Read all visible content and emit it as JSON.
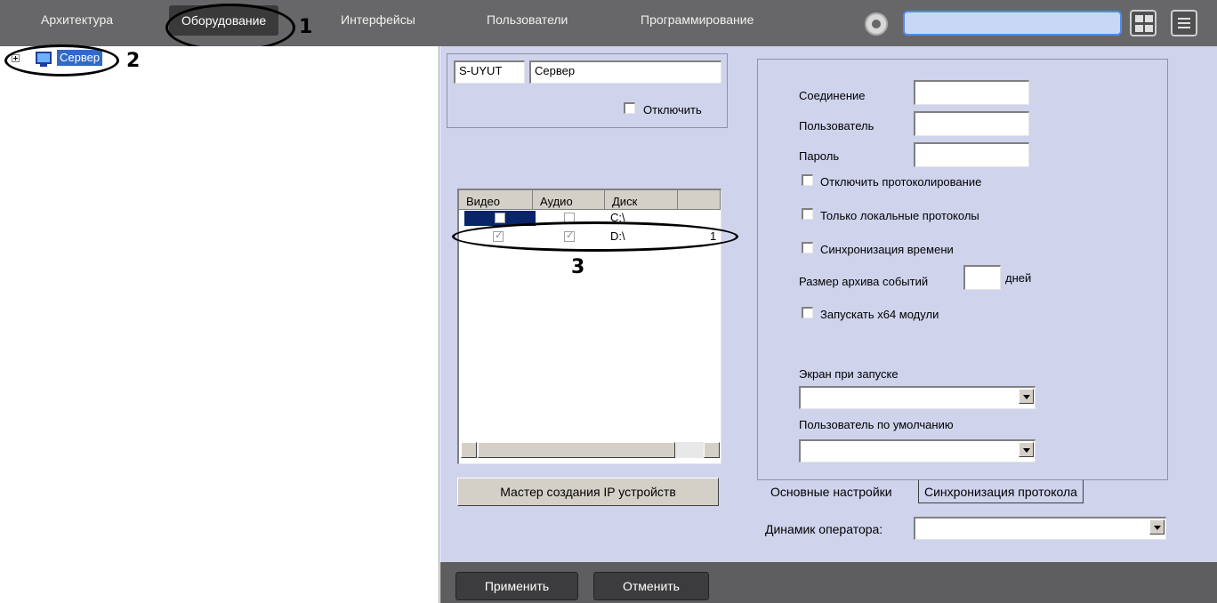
{
  "nav": {
    "tabs": [
      "Архитектура",
      "Оборудование",
      "Интерфейсы",
      "Пользователи",
      "Программирование"
    ],
    "active_tab": "Оборудование"
  },
  "callouts": [
    "1",
    "2",
    "3"
  ],
  "tree": {
    "root_label": "Сервер"
  },
  "server": {
    "id": "S-UYUT",
    "name": "Сервер",
    "disable_label": "Отключить"
  },
  "disks": {
    "columns": [
      "Видео",
      "Аудио",
      "Диск"
    ],
    "rows": [
      {
        "video": false,
        "audio": false,
        "disk": "C:\\",
        "extra": "",
        "video_selected": true
      },
      {
        "video": true,
        "audio": true,
        "disk": "D:\\",
        "extra": "1",
        "video_selected": false
      }
    ]
  },
  "settings": {
    "connection_label": "Соединение",
    "user_label": "Пользователь",
    "password_label": "Пароль",
    "disable_logging": "Отключить протоколирование",
    "local_logs_only": "Только локальные протоколы",
    "time_sync": "Синхронизация времени",
    "archive_size_label": "Размер архива событий",
    "archive_units": "дней",
    "run_x64": "Запускать x64 модули",
    "startup_screen_label": "Экран при запуске",
    "default_user_label": "Пользователь по умолчанию"
  },
  "tabs": {
    "basic": "Основные настройки",
    "sync": "Синхронизация протокола"
  },
  "operator_speaker_label": "Динамик оператора:",
  "ip_wizard_button": "Мастер создания IP устройств",
  "buttons": {
    "apply": "Применить",
    "cancel": "Отменить"
  },
  "colors": {
    "topbar": "#676769",
    "panel": "#cfd3ec",
    "bottom_bar": "#5e5e60",
    "selection": "#316ac5",
    "search_border": "#4f8cf0"
  },
  "icons": [
    "settings-gear-icon",
    "layout-grid-icon",
    "menu-list-icon",
    "monitor-icon",
    "tree-expand-icon"
  ]
}
